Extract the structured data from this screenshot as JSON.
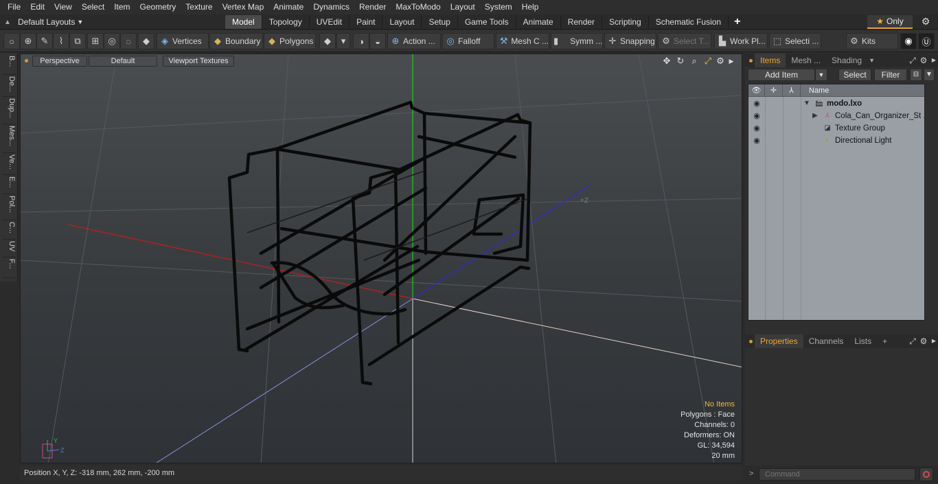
{
  "menu": [
    "File",
    "Edit",
    "View",
    "Select",
    "Item",
    "Geometry",
    "Texture",
    "Vertex Map",
    "Animate",
    "Dynamics",
    "Render",
    "MaxToModo",
    "Layout",
    "System",
    "Help"
  ],
  "layout_selector": "Default Layouts",
  "tabs": [
    "Model",
    "Topology",
    "UVEdit",
    "Paint",
    "Layout",
    "Setup",
    "Game Tools",
    "Animate",
    "Render",
    "Scripting",
    "Schematic Fusion"
  ],
  "active_tab": "Model",
  "only_button": "Only",
  "toolbar": {
    "vertices": "Vertices",
    "boundary": "Boundary",
    "polygons": "Polygons",
    "action": "Action ...",
    "falloff": "Falloff",
    "mesh": "Mesh C ...",
    "symm": "Symm ...",
    "snapping": "Snapping",
    "select_t": "Select T...",
    "work_plane": "Work Pl...",
    "selection": "Selecti ...",
    "kits": "Kits"
  },
  "left_tabs": [
    "B...",
    "De...",
    "Dup...",
    "Mes...",
    "Ve...",
    "E...",
    "Pol...",
    "C...",
    "UV",
    "F..."
  ],
  "viewport": {
    "view_mode": "Perspective",
    "shading": "Default",
    "textures": "Viewport Textures",
    "axis_z_label": "+Z",
    "info": {
      "selection": "No Items",
      "polygons": "Polygons : Face",
      "channels": "Channels: 0",
      "deformers": "Deformers: ON",
      "gl": "GL: 34,594",
      "scale": "20 mm"
    },
    "gizmo": {
      "y": "Y",
      "z": "Z"
    }
  },
  "status": "Position X, Y, Z:   -318 mm, 262 mm, -200 mm",
  "items_panel": {
    "tabs": [
      "Items",
      "Mesh ...",
      "Shading"
    ],
    "active_tab": "Items",
    "add_item": "Add Item",
    "select": "Select",
    "filter": "Filter",
    "column_name": "Name",
    "tree": [
      {
        "label": "modo.lxo",
        "bold": true
      },
      {
        "label": "Cola_Can_Organizer_St ...",
        "bold": false
      },
      {
        "label": "Texture Group",
        "bold": false
      },
      {
        "label": "Directional Light",
        "bold": false
      }
    ]
  },
  "properties_panel": {
    "tabs": [
      "Properties",
      "Channels",
      "Lists"
    ],
    "active_tab": "Properties"
  },
  "command_placeholder": "Command",
  "colors": {
    "accent": "#f0a632",
    "x_axis": "#c41c1c",
    "y_axis": "#22c822",
    "z_axis": "#2a2ad6"
  }
}
